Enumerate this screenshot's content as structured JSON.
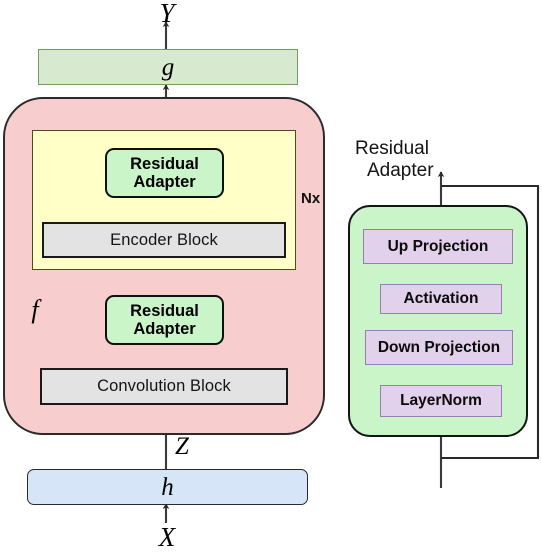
{
  "figure": {
    "io_labels": {
      "output": "Y",
      "latent": "Z",
      "input": "X"
    },
    "functions": {
      "g_label": "g",
      "f_label": "f",
      "h_label": "h"
    },
    "repeat_label": "Nx",
    "main_blocks": {
      "top_adapter": {
        "line1": "Residual",
        "line2": "Adapter"
      },
      "encoder_block": "Encoder Block",
      "mid_adapter": {
        "line1": "Residual",
        "line2": "Adapter"
      },
      "convolution_block": "Convolution Block"
    },
    "detail_panel": {
      "title_line1": "Residual",
      "title_line2": "Adapter",
      "stack": [
        "Up Projection",
        "Activation",
        "Down Projection",
        "LayerNorm"
      ]
    },
    "colors": {
      "outer_f_fill": "#f7cdcd",
      "encoder_group_fill": "#ffffc8",
      "adapter_fill": "#c9f5c9",
      "gray_block_fill": "#e3e3e3",
      "bar_g_fill": "#d7ead0",
      "bar_h_fill": "#d6e5f7",
      "purple_block_fill": "#e2d1ea",
      "stroke": "#141414"
    }
  }
}
